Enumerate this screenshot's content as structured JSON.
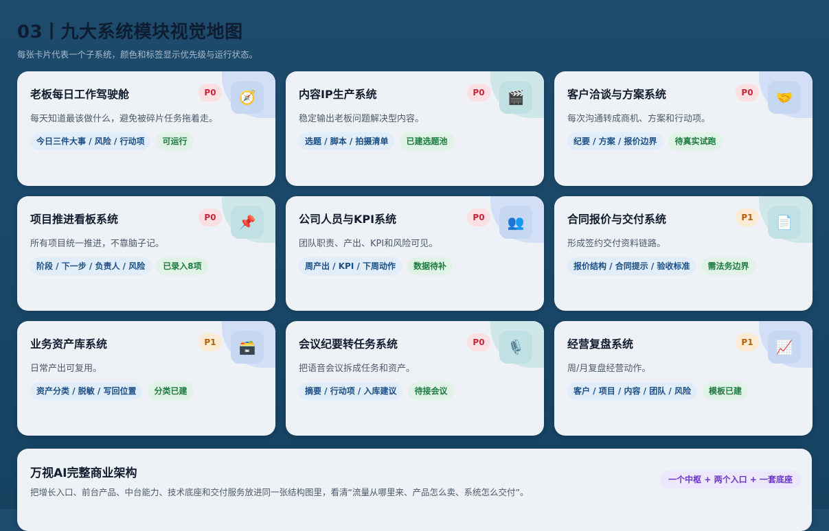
{
  "header": {
    "title": "03丨九大系统模块视觉地图",
    "subtitle": "每张卡片代表一个子系统，颜色和标签显示优先级与运行状态。"
  },
  "cards": [
    {
      "title": "老板每日工作驾驶舱",
      "priority": "P0",
      "icon": "compass-icon",
      "glyph": "🧭",
      "desc": "每天知道最该做什么，避免被碎片任务拖着走。",
      "tag": "今日三件大事 / 风险 / 行动项",
      "status": "可运行"
    },
    {
      "title": "内容IP生产系统",
      "priority": "P0",
      "icon": "clapperboard-icon",
      "glyph": "🎬",
      "desc": "稳定输出老板问题解决型内容。",
      "tag": "选题 / 脚本 / 拍摄清单",
      "status": "已建选题池"
    },
    {
      "title": "客户洽谈与方案系统",
      "priority": "P0",
      "icon": "handshake-icon",
      "glyph": "🤝",
      "desc": "每次沟通转成商机、方案和行动项。",
      "tag": "纪要 / 方案 / 报价边界",
      "status": "待真实试跑"
    },
    {
      "title": "项目推进看板系统",
      "priority": "P0",
      "icon": "pushpin-icon",
      "glyph": "📌",
      "desc": "所有项目统一推进，不靠脑子记。",
      "tag": "阶段 / 下一步 / 负责人 / 风险",
      "status": "已录入8项"
    },
    {
      "title": "公司人员与KPI系统",
      "priority": "P0",
      "icon": "people-icon",
      "glyph": "👥",
      "desc": "团队职责、产出、KPI和风险可见。",
      "tag": "周产出 / KPI / 下周动作",
      "status": "数据待补"
    },
    {
      "title": "合同报价与交付系统",
      "priority": "P1",
      "icon": "document-icon",
      "glyph": "📄",
      "desc": "形成签约交付资料链路。",
      "tag": "报价结构 / 合同提示 / 验收标准",
      "status": "需法务边界"
    },
    {
      "title": "业务资产库系统",
      "priority": "P1",
      "icon": "archive-box-icon",
      "glyph": "🗃️",
      "desc": "日常产出可复用。",
      "tag": "资产分类 / 脱敏 / 写回位置",
      "status": "分类已建"
    },
    {
      "title": "会议纪要转任务系统",
      "priority": "P0",
      "icon": "microphone-icon",
      "glyph": "🎙️",
      "desc": "把语音会议拆成任务和资产。",
      "tag": "摘要 / 行动项 / 入库建议",
      "status": "待接会议"
    },
    {
      "title": "经营复盘系统",
      "priority": "P1",
      "icon": "chart-up-icon",
      "glyph": "📈",
      "desc": "周/月复盘经营动作。",
      "tag": "客户 / 项目 / 内容 / 团队 / 风险",
      "status": "模板已建"
    }
  ],
  "colors": {
    "p0_badge": "#c5283a",
    "p1_badge": "#b4620e",
    "status_tag": "#1c7c3f",
    "info_tag": "#1b4f86"
  },
  "footer": {
    "title": "万视AI完整商业架构",
    "desc": "把增长入口、前台产品、中台能力、技术底座和交付服务放进同一张结构图里，看清“流量从哪里来、产品怎么卖、系统怎么交付”。",
    "pill": "一个中枢 + 两个入口 + 一套底座"
  }
}
